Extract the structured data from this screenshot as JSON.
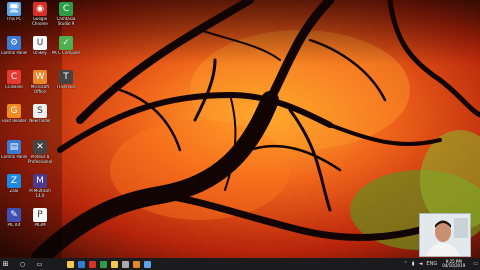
{
  "desktop": {
    "icons": [
      {
        "label": "This PC",
        "icon": "this-pc-icon",
        "color": "#5aa3e6",
        "glyph": "🖥"
      },
      {
        "label": "Google Chrome",
        "icon": "chrome-icon",
        "color": "#d93025",
        "glyph": "◉"
      },
      {
        "label": "Camtasia Studio 9",
        "icon": "camtasia-icon",
        "color": "#2e9e46",
        "glyph": "C"
      },
      {
        "label": "Control Panel",
        "icon": "control-panel-icon",
        "color": "#3a7bd5",
        "glyph": "⚙"
      },
      {
        "label": "Unikey",
        "icon": "unikey-icon",
        "color": "#ffffff",
        "glyph": "U"
      },
      {
        "label": "PK C Compiler",
        "icon": "pk-c-compiler-icon",
        "color": "#4caf50",
        "glyph": "✓"
      },
      {
        "label": "CCleaner",
        "icon": "ccleaner-icon",
        "color": "#e53935",
        "glyph": "C"
      },
      {
        "label": "Microsoft Office",
        "icon": "office-icon",
        "color": "#e8862a",
        "glyph": "W"
      },
      {
        "label": "TFService",
        "icon": "tfservice-icon",
        "color": "#444444",
        "glyph": "T"
      },
      {
        "label": "Foxit Reader",
        "icon": "foxit-reader-icon",
        "color": "#f08a24",
        "glyph": "G"
      },
      {
        "label": "New folder",
        "icon": "new-folder-icon",
        "color": "#eeeeee",
        "glyph": "S"
      },
      {
        "label": "Control Panel",
        "icon": "control-panel-2-icon",
        "color": "#3a7bd5",
        "glyph": "▤"
      },
      {
        "label": "Proteus 8 Professional",
        "icon": "proteus-icon",
        "color": "#444444",
        "glyph": "✕"
      },
      {
        "label": "Zalo",
        "icon": "zalo-icon",
        "color": "#1e88e5",
        "glyph": "Z"
      },
      {
        "label": "M Multisim 14.0",
        "icon": "multisim-icon",
        "color": "#4a3a8c",
        "glyph": "M"
      },
      {
        "label": "PIC Kit",
        "icon": "pickit-icon",
        "color": "#3f51b5",
        "glyph": "✎"
      },
      {
        "label": "PK3M",
        "icon": "pk3m-icon",
        "color": "#ffffff",
        "glyph": "P"
      }
    ]
  },
  "taskbar": {
    "start_glyph": "⊞",
    "search_glyph": "○",
    "taskview_glyph": "▭",
    "apps": [
      {
        "name": "file-explorer-icon",
        "color": "#f2c94c"
      },
      {
        "name": "edge-icon",
        "color": "#2d7dd2"
      },
      {
        "name": "chrome-icon",
        "color": "#d93025"
      },
      {
        "name": "camtasia-icon",
        "color": "#2e9e46"
      },
      {
        "name": "folder-icon",
        "color": "#f2c94c"
      },
      {
        "name": "explorer-icon",
        "color": "#aaaaaa"
      },
      {
        "name": "media-icon",
        "color": "#e8862a"
      },
      {
        "name": "app-icon",
        "color": "#5aa3e6"
      }
    ],
    "tray": {
      "lang": "ENG",
      "time": "9:25 PM",
      "date": "04/10/2019"
    }
  }
}
